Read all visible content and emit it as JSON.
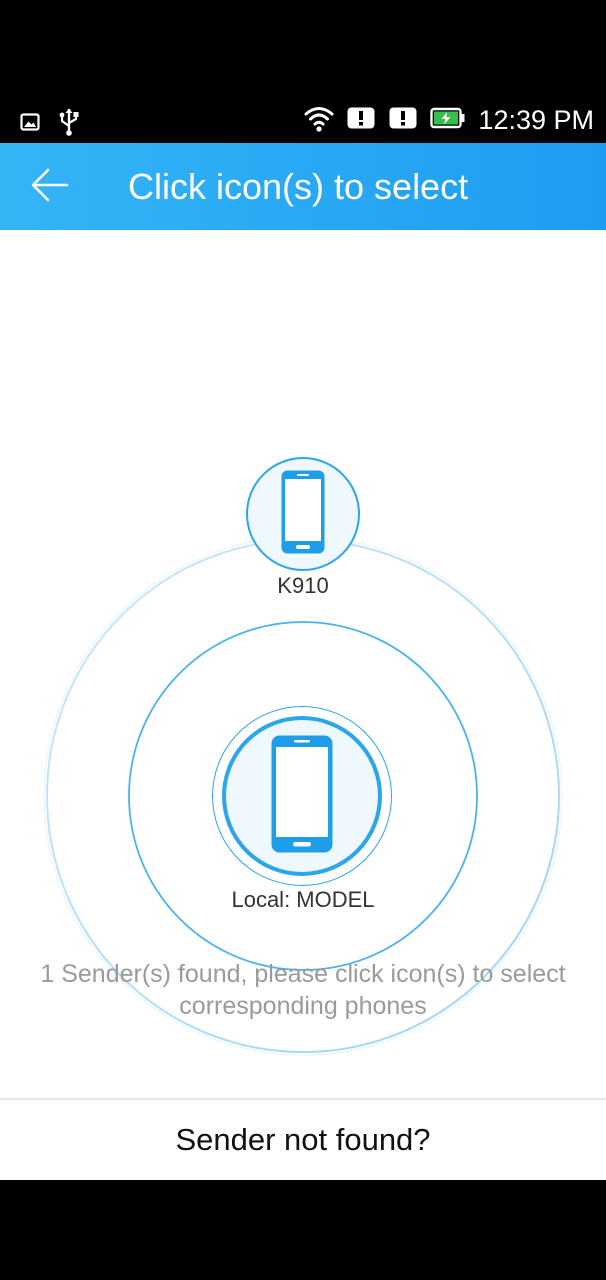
{
  "status_bar": {
    "time": "12:39 PM",
    "left_icons": [
      "image-notification-icon",
      "usb-icon"
    ],
    "right_icons": [
      "wifi-icon",
      "alert-icon",
      "alert-icon",
      "battery-charging-icon"
    ]
  },
  "app_bar": {
    "title": "Click icon(s) to select",
    "back_icon": "arrow-left-icon",
    "background": "#1ea5f3"
  },
  "radar": {
    "remote_device": {
      "label": "K910",
      "icon": "phone-icon"
    },
    "local_device": {
      "label": "Local: MODEL",
      "icon": "phone-icon"
    },
    "hint": "1 Sender(s) found, please click icon(s) to select corresponding phones",
    "accent_color": "#2ba6ea"
  },
  "footer": {
    "not_found_label": "Sender not found?"
  }
}
